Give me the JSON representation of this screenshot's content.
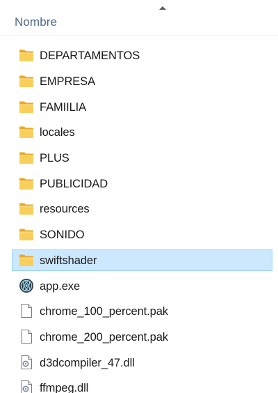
{
  "header": {
    "column_name": "Nombre"
  },
  "files": [
    {
      "name": "DEPARTAMENTOS",
      "icon": "folder-icon",
      "selected": false
    },
    {
      "name": "EMPRESA",
      "icon": "folder-icon",
      "selected": false
    },
    {
      "name": "FAMIILIA",
      "icon": "folder-icon",
      "selected": false
    },
    {
      "name": "locales",
      "icon": "folder-icon",
      "selected": false
    },
    {
      "name": "PLUS",
      "icon": "folder-icon",
      "selected": false
    },
    {
      "name": "PUBLICIDAD",
      "icon": "folder-icon",
      "selected": false
    },
    {
      "name": "resources",
      "icon": "folder-icon",
      "selected": false
    },
    {
      "name": "SONIDO",
      "icon": "folder-icon",
      "selected": false
    },
    {
      "name": "swiftshader",
      "icon": "folder-icon",
      "selected": true
    },
    {
      "name": "app.exe",
      "icon": "app-exe-icon",
      "selected": false
    },
    {
      "name": "chrome_100_percent.pak",
      "icon": "file-icon",
      "selected": false
    },
    {
      "name": "chrome_200_percent.pak",
      "icon": "file-icon",
      "selected": false
    },
    {
      "name": "d3dcompiler_47.dll",
      "icon": "dll-icon",
      "selected": false
    },
    {
      "name": "ffmpeg.dll",
      "icon": "dll-icon",
      "selected": false
    }
  ],
  "colors": {
    "folder": "#f5c242",
    "selection_bg": "#cce8ff",
    "selection_border": "#99d1ff",
    "header_text": "#4d6a8a"
  }
}
